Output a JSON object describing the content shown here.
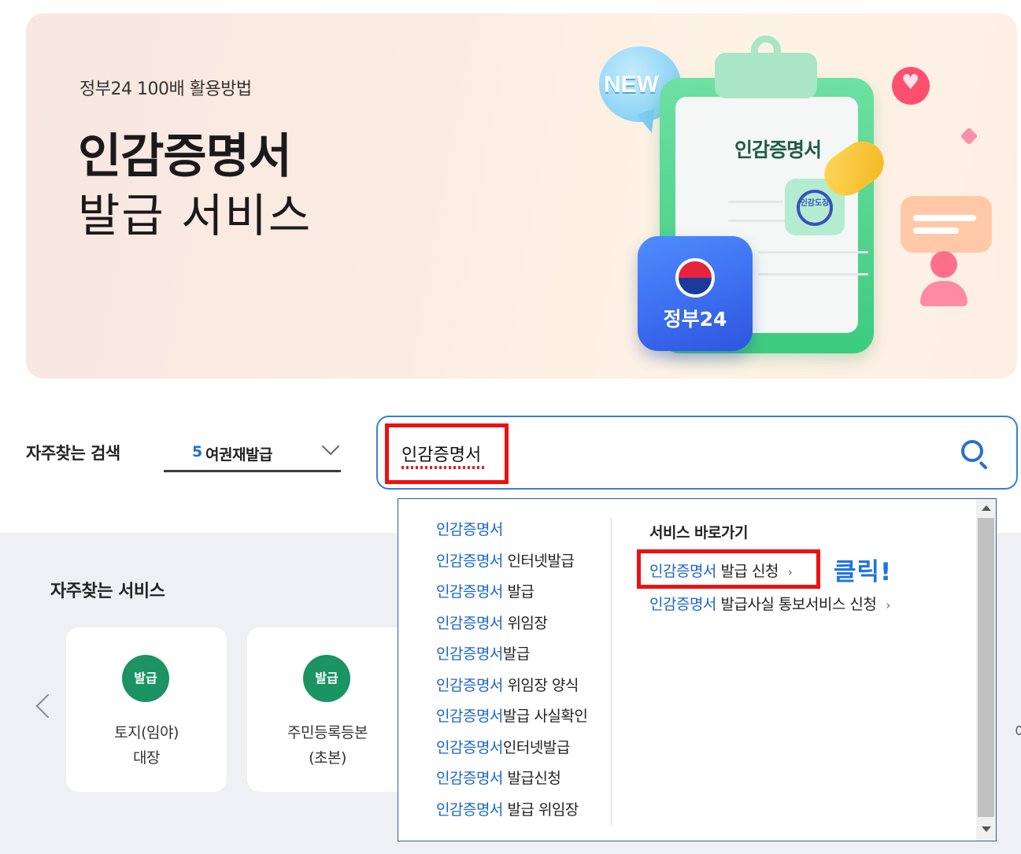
{
  "banner": {
    "subtitle": "정부24 100배 활용방법",
    "title_line1": "인감증명서",
    "title_line2": "발급 서비스",
    "illustration": {
      "new_badge": "NEW",
      "paper_title": "인감증명서",
      "seal_text": "인감도장",
      "app_label": "정부24"
    }
  },
  "frequent_search": {
    "label": "자주찾는 검색",
    "selected_rank": "5",
    "selected_text": "여권재발급"
  },
  "search": {
    "value": "인감증명서"
  },
  "autocomplete": {
    "highlight": "인감증명서",
    "suggestions": [
      {
        "hl": "인감증명서",
        "rest": ""
      },
      {
        "hl": "인감증명서",
        "rest": " 인터넷발급"
      },
      {
        "hl": "인감증명서",
        "rest": " 발급"
      },
      {
        "hl": "인감증명서",
        "rest": " 위임장"
      },
      {
        "hl": "인감증명서",
        "rest": "발급"
      },
      {
        "hl": "인감증명서",
        "rest": " 위임장 양식"
      },
      {
        "hl": "인감증명서",
        "rest": "발급 사실확인"
      },
      {
        "hl": "인감증명서",
        "rest": "인터넷발급"
      },
      {
        "hl": "인감증명서",
        "rest": " 발급신청"
      },
      {
        "hl": "인감증명서",
        "rest": " 발급 위임장"
      }
    ],
    "shortcuts_title": "서비스 바로가기",
    "shortcuts": [
      {
        "hl": "인감증명서",
        "rest": " 발급 신청",
        "arrow": "›"
      },
      {
        "hl": "인감증명서",
        "rest": " 발급사실 통보서비스 신청",
        "arrow": "›"
      }
    ],
    "click_note": "클릭!"
  },
  "frequent_services": {
    "title": "자주찾는 서비스",
    "cards": [
      {
        "badge": "발급",
        "line1": "토지(임야)",
        "line2": "대장"
      },
      {
        "badge": "발급",
        "line1": "주민등록등본",
        "line2": "(초본)"
      }
    ],
    "edge_char": "이"
  },
  "colors": {
    "accent_blue": "#1a66c9",
    "highlight_red": "#ee1111",
    "badge_green": "#1b9362"
  }
}
